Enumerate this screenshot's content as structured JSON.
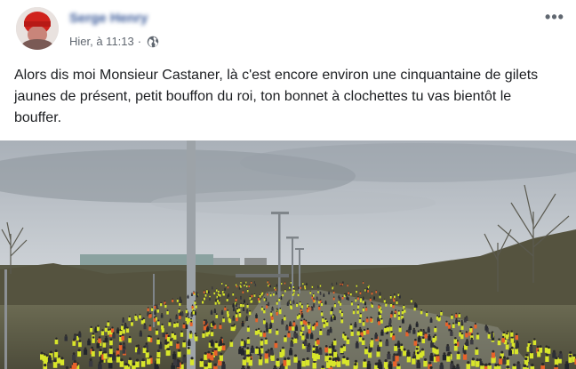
{
  "post": {
    "author_name": "Serge Henry",
    "timestamp": "Hier, à 11:13",
    "separator": "·",
    "privacy_icon": "globe-icon",
    "more_icon": "more-options-icon",
    "more_label": "•••",
    "message": "Alors dis moi Monsieur Castaner, là c'est encore environ une cinquantaine de gilets jaunes de présent, petit bouffon du roi, ton bonnet à clochettes tu vas bientôt le bouffer."
  },
  "colors": {
    "author": "#385898",
    "meta": "#606770",
    "text": "#1c1e21",
    "vest_yellow": "#d8e62a",
    "vest_orange": "#e8622a"
  }
}
